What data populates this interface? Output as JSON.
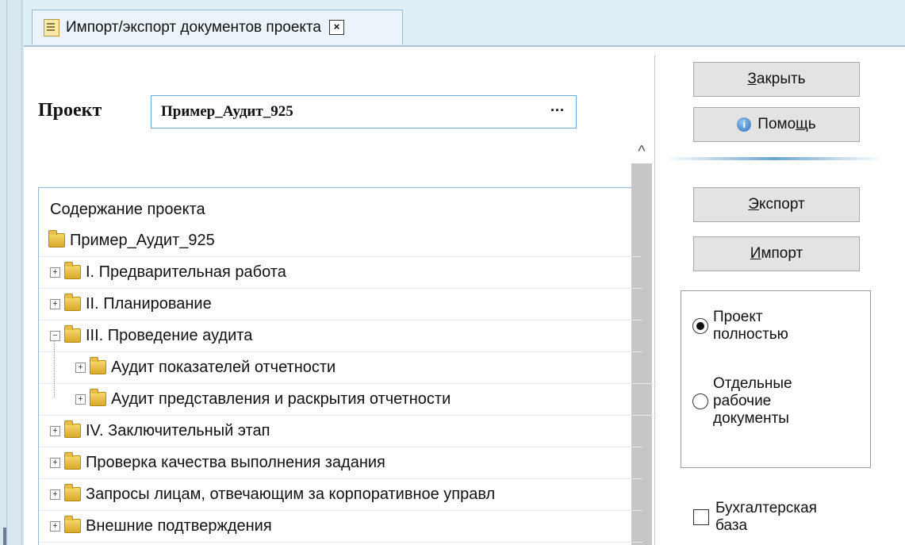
{
  "tab": {
    "title": "Импорт/экспорт документов проекта",
    "close_glyph": "×"
  },
  "project": {
    "label": "Проект",
    "value": "Пример_Аудит_925",
    "ellipsis": "···"
  },
  "tree": {
    "caption": "Содержание проекта",
    "items": [
      {
        "label": "Пример_Аудит_925",
        "expander": ""
      },
      {
        "label": "I. Предварительная работа",
        "expander": "+"
      },
      {
        "label": "II. Планирование",
        "expander": "+"
      },
      {
        "label": "III. Проведение аудита",
        "expander": "−"
      },
      {
        "label": "Аудит показателей отчетности",
        "expander": "+"
      },
      {
        "label": "Аудит представления и раскрытия отчетности",
        "expander": "+"
      },
      {
        "label": "IV. Заключительный этап",
        "expander": "+"
      },
      {
        "label": "Проверка качества выполнения задания",
        "expander": "+"
      },
      {
        "label": "Запросы лицам, отвечающим за корпоративное управл",
        "expander": "+"
      },
      {
        "label": "Внешние подтверждения",
        "expander": "+"
      }
    ]
  },
  "buttons": {
    "close": {
      "mnemonic": "З",
      "rest": "акрыть"
    },
    "help": {
      "pre": "Помо",
      "mnemonic": "щ",
      "rest": "ь",
      "icon": "i"
    },
    "export": {
      "mnemonic": "Э",
      "rest": "кспорт"
    },
    "import": {
      "mnemonic": "И",
      "rest": "мпорт"
    }
  },
  "options": {
    "full_line1": "Проект",
    "full_line2": "полностью",
    "separate_line1": "Отдельные",
    "separate_line2": "рабочие",
    "separate_line3": "документы",
    "selected": "full"
  },
  "checkbox": {
    "line1": "Бухгалтерская",
    "line2": "база",
    "checked": false
  },
  "scroll": {
    "up_glyph": "^"
  }
}
